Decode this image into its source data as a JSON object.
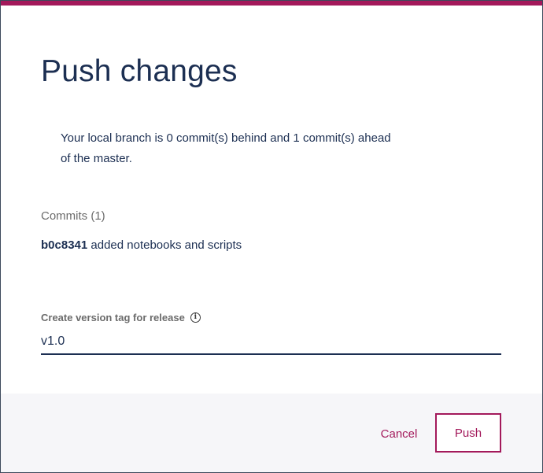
{
  "dialog": {
    "title": "Push changes",
    "status_message": "Your local branch is 0 commit(s) behind and 1 commit(s) ahead of the master.",
    "accent_color": "#a3195b",
    "text_color": "#1c2f52"
  },
  "commits": {
    "heading": "Commits (1)",
    "items": [
      {
        "hash": "b0c8341",
        "message": " added notebooks and scripts"
      }
    ]
  },
  "version_tag": {
    "label": "Create version tag for release",
    "info_icon": "info-icon",
    "value": "v1.0"
  },
  "footer": {
    "cancel_label": "Cancel",
    "push_label": "Push"
  }
}
